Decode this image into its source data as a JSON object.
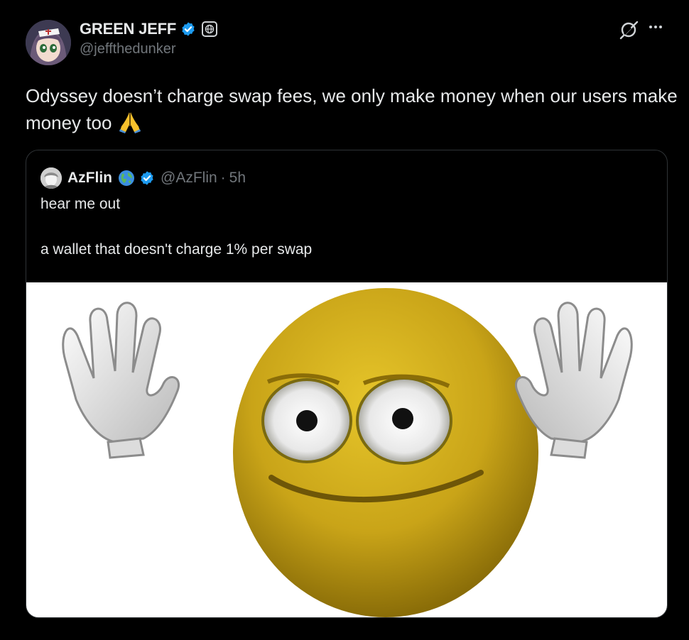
{
  "post": {
    "display_name": "GREEN JEFF",
    "handle": "@jeffthedunker",
    "text": "Odyssey doesn’t charge swap fees, we only make money when our users make money too",
    "emoji": "folded-hands-emoji",
    "icons": {
      "verified": "verified-badge-icon",
      "affiliation": "globe-affiliation-icon",
      "grok": "grok-icon",
      "more": "more-options-icon"
    }
  },
  "quote": {
    "display_name": "AzFlin",
    "handle": "@AzFlin",
    "separator": "·",
    "time": "5h",
    "line1": "hear me out",
    "line2": "a wallet that doesn't charge 1% per swap",
    "media": "waving-emoji-image"
  },
  "colors": {
    "background": "#000000",
    "text": "#e7e9ea",
    "muted": "#71767b",
    "verified": "#1d9bf0",
    "border": "#2f3336"
  }
}
